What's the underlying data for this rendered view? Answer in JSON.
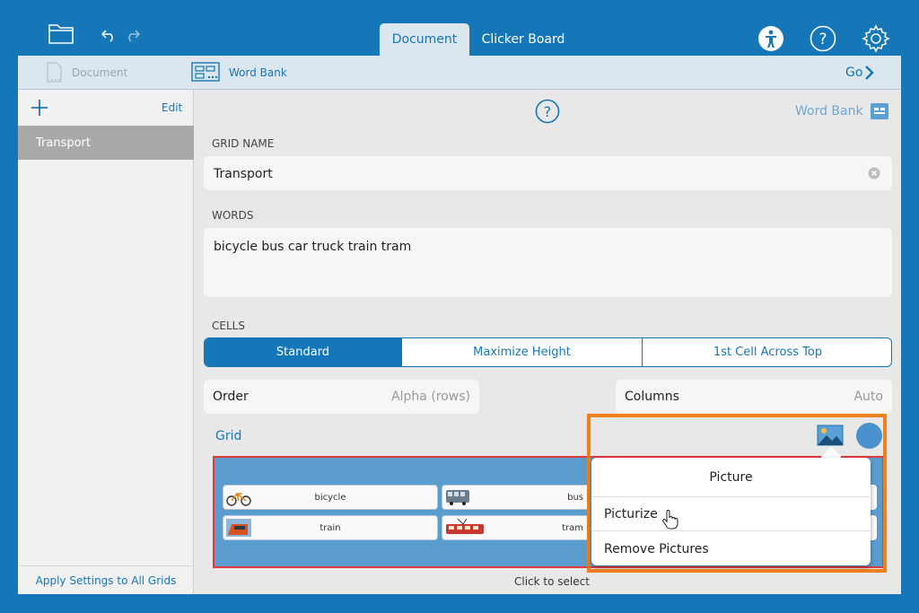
{
  "topbar": {
    "tabs": [
      {
        "label": "Document",
        "active": true
      },
      {
        "label": "Clicker Board",
        "active": false
      }
    ]
  },
  "subbar": {
    "document_label": "Document",
    "wordbank_label": "Word Bank",
    "go_label": "Go"
  },
  "sidebar": {
    "edit_label": "Edit",
    "items": [
      {
        "label": "Transport",
        "selected": true
      }
    ],
    "footer": "Apply Settings to All Grids"
  },
  "main": {
    "wordbank_link": "Word Bank",
    "grid_name_label": "GRID NAME",
    "grid_name_value": "Transport",
    "words_label": "WORDS",
    "words_value": "bicycle bus car truck train tram",
    "cells_label": "CELLS",
    "cells_options": [
      {
        "label": "Standard",
        "selected": true
      },
      {
        "label": "Maximize Height",
        "selected": false
      },
      {
        "label": "1st Cell Across Top",
        "selected": false
      }
    ],
    "order_label": "Order",
    "order_value": "Alpha (rows)",
    "columns_label": "Columns",
    "columns_value": "Auto",
    "grid_label": "Grid",
    "grid_cells": [
      {
        "label": "bicycle"
      },
      {
        "label": "bus"
      },
      {
        "label": "train"
      },
      {
        "label": "tram"
      }
    ],
    "click_hint": "Click to select"
  },
  "popover": {
    "title": "Picture",
    "items": [
      "Picturize",
      "Remove Pictures"
    ]
  },
  "colors": {
    "accent": "#1576b8",
    "highlight": "#f07f1e",
    "grid_bg": "#5b9ccf",
    "grid_border": "#e0393e"
  }
}
